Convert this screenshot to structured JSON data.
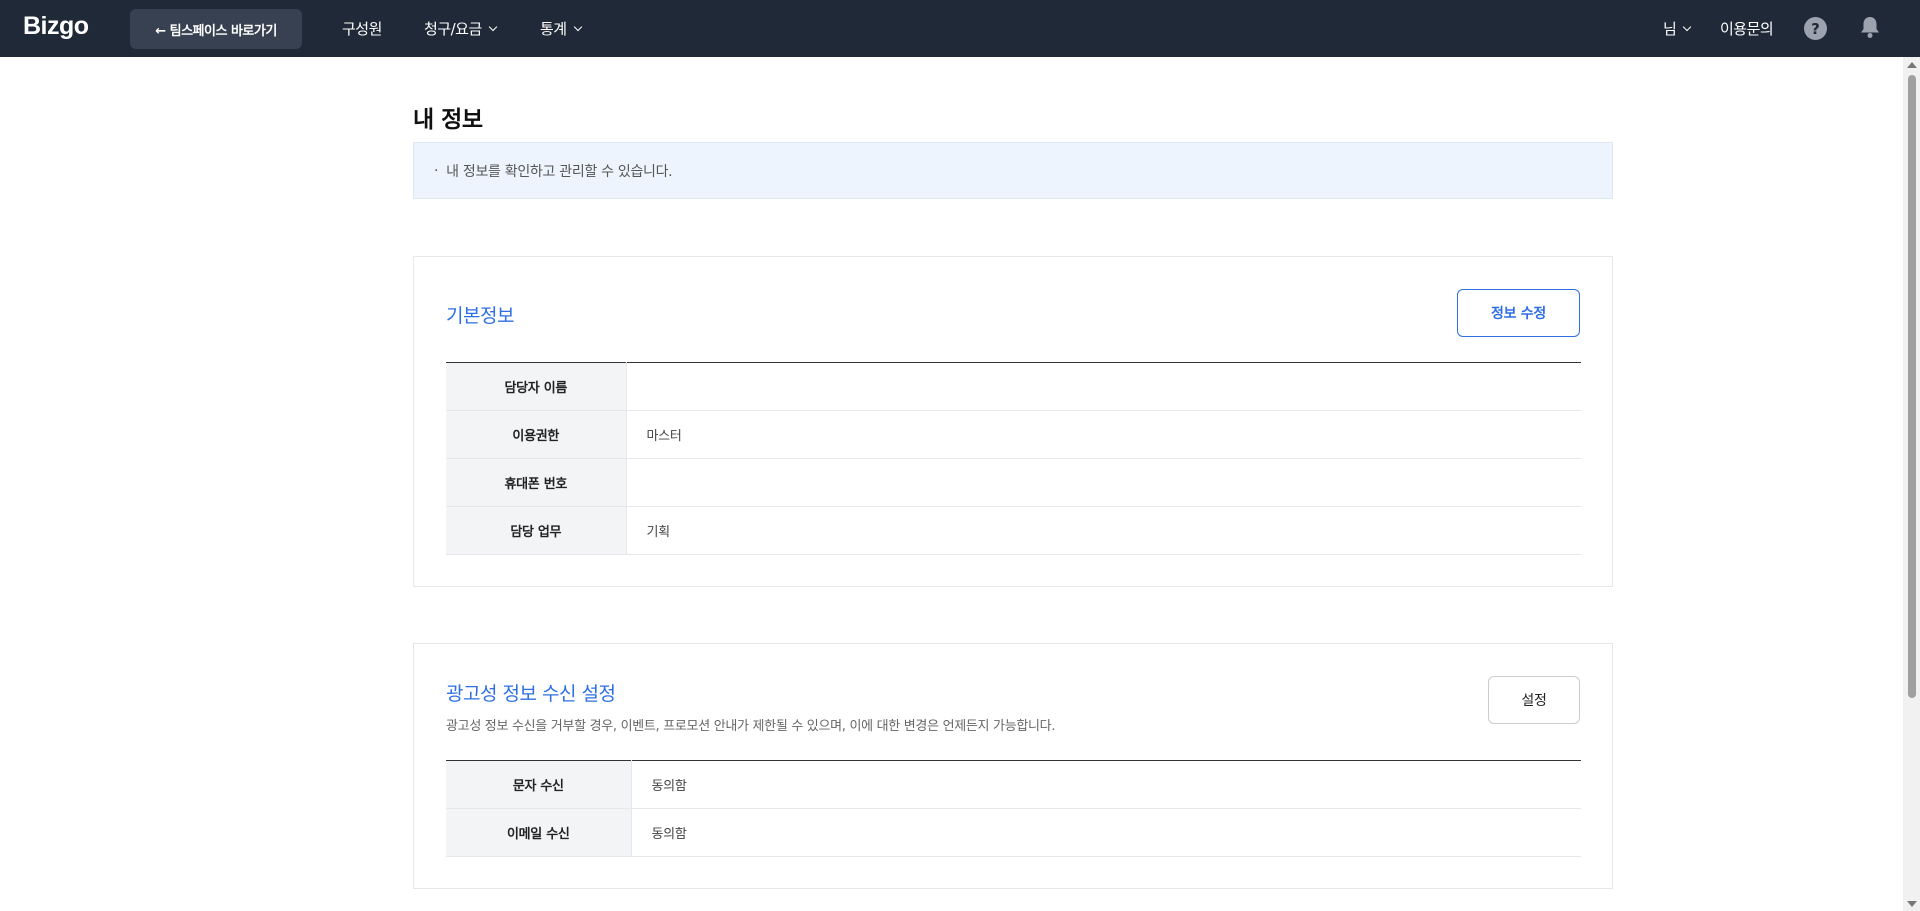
{
  "header": {
    "logo": "Bizgo",
    "back_button": "← 팀스페이스 바로가기",
    "nav": [
      {
        "label": "구성원"
      },
      {
        "label": "청구/요금"
      },
      {
        "label": "통계"
      }
    ],
    "user_menu": "님",
    "inquiry": "이용문의",
    "help_symbol": "?"
  },
  "page": {
    "title": "내 정보",
    "notice": "내 정보를 확인하고 관리할 수 있습니다.",
    "notice_bullet": "·"
  },
  "basic_info": {
    "title": "기본정보",
    "edit_button": "정보 수정",
    "rows": [
      {
        "label": "담당자 이름",
        "value": ""
      },
      {
        "label": "이용권한",
        "value": "마스터"
      },
      {
        "label": "휴대폰 번호",
        "value": ""
      },
      {
        "label": "담당 업무",
        "value": "기획"
      }
    ]
  },
  "marketing": {
    "title": "광고성 정보 수신 설정",
    "description": "광고성 정보 수신을 거부할 경우, 이벤트, 프로모션 안내가 제한될 수 있으며, 이에 대한 변경은 언제든지 가능합니다.",
    "settings_button": "설정",
    "rows": [
      {
        "label": "문자 수신",
        "value": "동의함"
      },
      {
        "label": "이메일 수신",
        "value": "동의함"
      }
    ]
  },
  "colors": {
    "topbar": "#1f2937",
    "accent": "#2f6fe4",
    "notice_bg": "#eef4fd"
  }
}
